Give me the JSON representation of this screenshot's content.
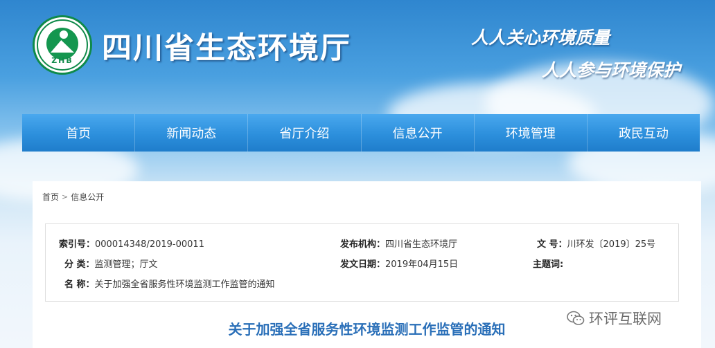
{
  "header": {
    "logo_text": "ZHB",
    "site_title": "四川省生态环境厅",
    "slogan_1": "人人关心环境质量",
    "slogan_2": "人人参与环境保护"
  },
  "nav": {
    "items": [
      "首页",
      "新闻动态",
      "省厅介绍",
      "信息公开",
      "环境管理",
      "政民互动"
    ]
  },
  "breadcrumb": {
    "home": "首页",
    "separator": ">",
    "current": "信息公开"
  },
  "info": {
    "index_label": "索引号：",
    "index_value": "000014348/2019-00011",
    "publisher_label": "发布机构：",
    "publisher_value": "四川省生态环境厅",
    "docno_label": "文 号：",
    "docno_value": "川环发〔2019〕25号",
    "category_label": "分 类：",
    "category_value": "监测管理；厅文",
    "date_label": "发文日期：",
    "date_value": "2019年04月15日",
    "subject_label": "主题词:",
    "subject_value": "",
    "name_label": "名 称：",
    "name_value": "关于加强全省服务性环境监测工作监管的通知"
  },
  "document": {
    "title": "关于加强全省服务性环境监测工作监管的通知"
  },
  "watermark": {
    "text": "环评互联网",
    "icon": "wechat-icon"
  },
  "colors": {
    "nav_blue": "#2c8fdc",
    "title_blue": "#2a6fb8",
    "logo_green": "#0f8a4a"
  }
}
